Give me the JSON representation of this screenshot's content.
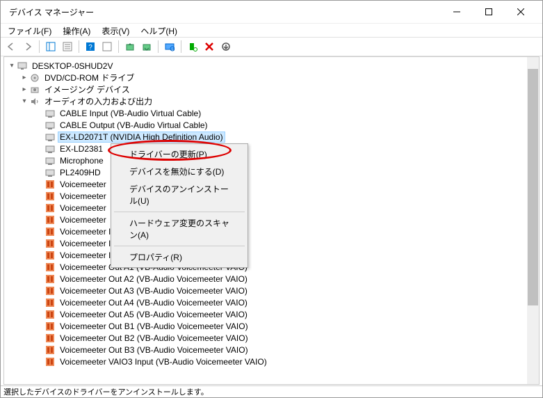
{
  "window": {
    "title": "デバイス マネージャー"
  },
  "menu": {
    "file": "ファイル(F)",
    "action": "操作(A)",
    "view": "表示(V)",
    "help": "ヘルプ(H)"
  },
  "tree": {
    "root": "DESKTOP-0SHUD2V",
    "dvd": "DVD/CD-ROM ドライブ",
    "imaging": "イメージング デバイス",
    "audio_cat": "オーディオの入力および出力",
    "items": [
      "CABLE Input (VB-Audio Virtual Cable)",
      "CABLE Output (VB-Audio Virtual Cable)",
      "EX-LD2071T (NVIDIA High Definition Audio)",
      "EX-LD2381",
      "Microphone",
      "PL2409HD",
      "Voicemeeter",
      "Voicemeeter",
      "Voicemeeter",
      "Voicemeeter",
      "Voicemeeter In 4 (VB-Audio Voicemeeter VAIO)",
      "Voicemeeter In 5 (VB-Audio Voicemeeter VAIO)",
      "Voicemeeter Input (VB-Audio Voicemeeter VAIO)",
      "Voicemeeter Out A1 (VB-Audio Voicemeeter VAIO)",
      "Voicemeeter Out A2 (VB-Audio Voicemeeter VAIO)",
      "Voicemeeter Out A3 (VB-Audio Voicemeeter VAIO)",
      "Voicemeeter Out A4 (VB-Audio Voicemeeter VAIO)",
      "Voicemeeter Out A5 (VB-Audio Voicemeeter VAIO)",
      "Voicemeeter Out B1 (VB-Audio Voicemeeter VAIO)",
      "Voicemeeter Out B2 (VB-Audio Voicemeeter VAIO)",
      "Voicemeeter Out B3 (VB-Audio Voicemeeter VAIO)",
      "Voicemeeter VAIO3 Input (VB-Audio Voicemeeter VAIO)"
    ]
  },
  "context": {
    "update_driver": "ドライバーの更新(P)",
    "disable_device": "デバイスを無効にする(D)",
    "uninstall_device": "デバイスのアンインストール(U)",
    "scan_hardware": "ハードウェア変更のスキャン(A)",
    "properties": "プロパティ(R)"
  },
  "status": {
    "text": "選択したデバイスのドライバーをアンインストールします。"
  }
}
